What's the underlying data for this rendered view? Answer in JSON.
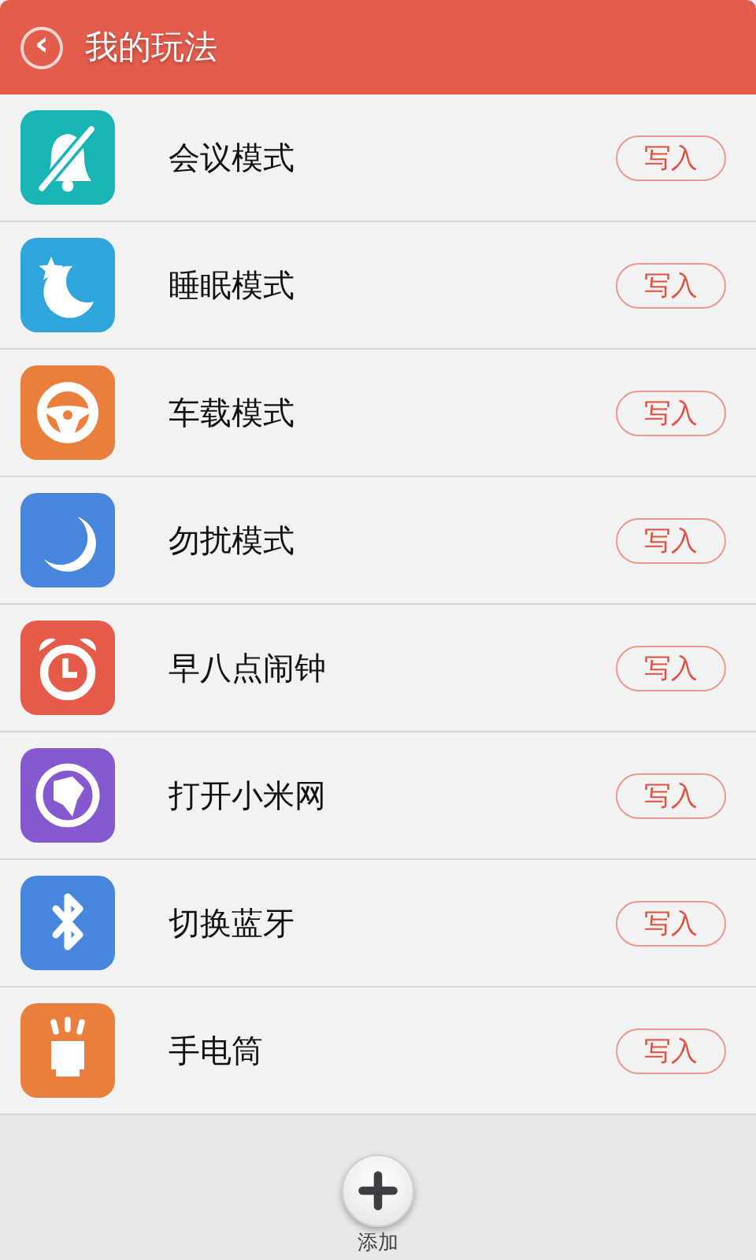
{
  "header": {
    "back": "‹",
    "title": "我的玩法"
  },
  "modes": [
    {
      "name": "会议模式",
      "color": "#17b5b5",
      "action": "写入"
    },
    {
      "name": "睡眠模式",
      "color": "#2ea6dc",
      "action": "写入"
    },
    {
      "name": "车载模式",
      "color": "#ea7f3d",
      "action": "写入"
    },
    {
      "name": "勿扰模式",
      "color": "#4687dd",
      "action": "写入"
    },
    {
      "name": "早八点闹钟",
      "color": "#e55a48",
      "action": "写入"
    },
    {
      "name": "打开小米网",
      "color": "#8459cf",
      "action": "写入"
    },
    {
      "name": "切换蓝牙",
      "color": "#4687dd",
      "action": "写入"
    },
    {
      "name": "手电筒",
      "color": "#ea7f3d",
      "action": "写入"
    }
  ],
  "add": {
    "label": "添加"
  }
}
